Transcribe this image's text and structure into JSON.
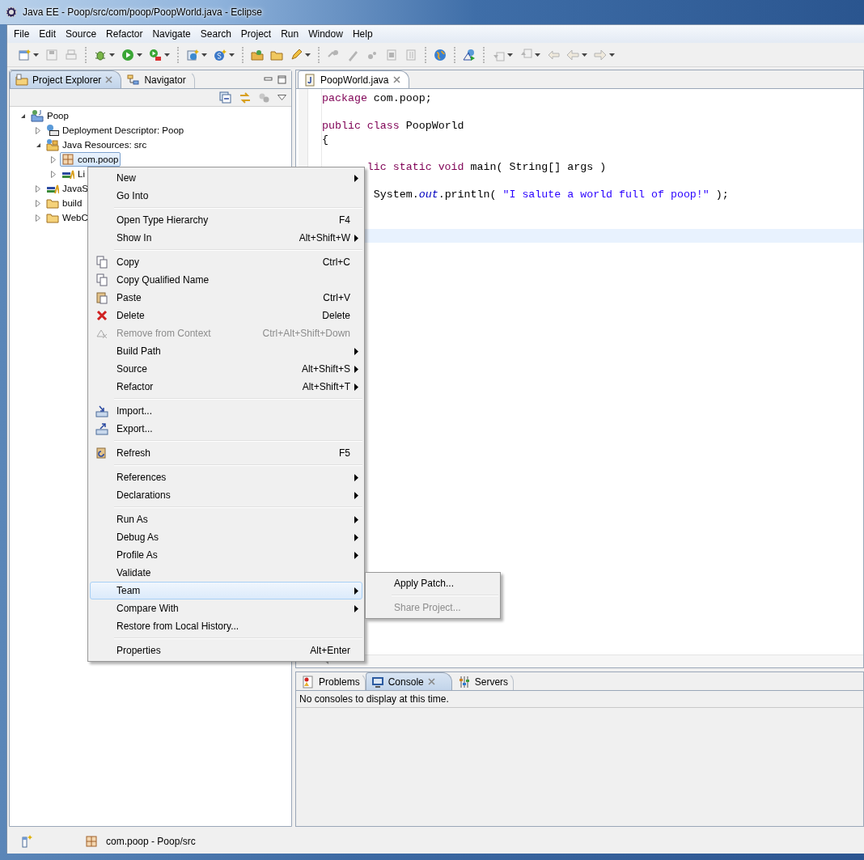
{
  "window": {
    "title": "Java EE - Poop/src/com/poop/PoopWorld.java - Eclipse"
  },
  "menubar": [
    "File",
    "Edit",
    "Source",
    "Refactor",
    "Navigate",
    "Search",
    "Project",
    "Run",
    "Window",
    "Help"
  ],
  "toolbar": [
    [
      {
        "dropdown": true,
        "disabled": false
      },
      {
        "dropdown": false,
        "disabled": true
      },
      {
        "dropdown": false,
        "disabled": true
      }
    ],
    [
      {
        "dropdown": true,
        "disabled": false
      },
      {
        "dropdown": true,
        "disabled": false
      },
      {
        "dropdown": true,
        "disabled": false
      }
    ],
    [
      {
        "dropdown": true,
        "disabled": false
      },
      {
        "dropdown": true,
        "disabled": false
      }
    ],
    [
      {
        "dropdown": false,
        "disabled": false
      },
      {
        "dropdown": false,
        "disabled": false
      },
      {
        "dropdown": true,
        "disabled": false
      }
    ],
    [
      {
        "dropdown": false,
        "disabled": true
      },
      {
        "dropdown": false,
        "disabled": true
      },
      {
        "dropdown": false,
        "disabled": true
      },
      {
        "dropdown": false,
        "disabled": true
      },
      {
        "dropdown": false,
        "disabled": true
      }
    ],
    [
      {
        "dropdown": false,
        "disabled": false
      }
    ],
    [
      {
        "dropdown": false,
        "disabled": false
      }
    ],
    [
      {
        "dropdown": true,
        "disabled": true
      },
      {
        "dropdown": true,
        "disabled": true
      },
      {
        "dropdown": false,
        "disabled": true
      },
      {
        "dropdown": true,
        "disabled": true
      },
      {
        "dropdown": true,
        "disabled": true
      }
    ]
  ],
  "project_explorer": {
    "tabs": [
      {
        "label": "Project Explorer",
        "selected": true
      },
      {
        "label": "Navigator",
        "selected": false
      }
    ],
    "tree": [
      {
        "label": "Poop",
        "kind": "project",
        "expanded": true,
        "selected": false,
        "children": [
          {
            "label": "Deployment Descriptor: Poop",
            "kind": "descriptor",
            "expanded": false,
            "selected": false
          },
          {
            "label": "Java Resources: src",
            "kind": "resources",
            "expanded": true,
            "selected": false,
            "children": [
              {
                "label": "com.poop",
                "kind": "package",
                "expanded": false,
                "selected": true
              },
              {
                "label": "Li",
                "kind": "library",
                "expanded": false,
                "selected": false
              }
            ]
          },
          {
            "label": "JavaS",
            "kind": "library",
            "expanded": false,
            "selected": false
          },
          {
            "label": "build",
            "kind": "folder",
            "expanded": false,
            "selected": false
          },
          {
            "label": "WebC",
            "kind": "folder",
            "expanded": false,
            "selected": false
          }
        ]
      }
    ]
  },
  "editor": {
    "tab": {
      "label": "PoopWorld.java"
    },
    "lines": [
      {
        "kind": "code",
        "current": false,
        "tokens": [
          {
            "kind": "keyword",
            "text": "package"
          },
          {
            "kind": "plain",
            "text": " com.poop;"
          }
        ]
      },
      {
        "kind": "blank",
        "current": false
      },
      {
        "kind": "code",
        "current": false,
        "tokens": [
          {
            "kind": "keyword",
            "text": "public"
          },
          {
            "kind": "keyword",
            "text": " class"
          },
          {
            "kind": "plain",
            "text": " PoopWorld"
          }
        ]
      },
      {
        "kind": "code",
        "current": false,
        "tokens": [
          {
            "kind": "plain",
            "text": "{"
          }
        ]
      },
      {
        "kind": "blank",
        "current": false
      },
      {
        "kind": "code",
        "current": false,
        "tokens": [
          {
            "kind": "keyword",
            "text": "       lic"
          },
          {
            "kind": "keyword",
            "text": " static"
          },
          {
            "kind": "keyword",
            "text": " void"
          },
          {
            "kind": "plain",
            "text": " main( String[] args )"
          }
        ]
      },
      {
        "kind": "blank",
        "current": false
      },
      {
        "kind": "code",
        "current": false,
        "tokens": [
          {
            "kind": "plain",
            "text": "        System."
          },
          {
            "kind": "field",
            "text": "out"
          },
          {
            "kind": "plain",
            "text": ".println( "
          },
          {
            "kind": "string",
            "text": "\"I salute a world full of poop!\""
          },
          {
            "kind": "plain",
            "text": " );"
          }
        ]
      },
      {
        "kind": "blank",
        "current": false
      },
      {
        "kind": "blank",
        "current": false
      },
      {
        "kind": "blank",
        "current": true
      }
    ]
  },
  "bottom_panel": {
    "tabs": [
      {
        "label": "Problems",
        "selected": false
      },
      {
        "label": "Console",
        "selected": true
      },
      {
        "label": "Servers",
        "selected": false
      }
    ],
    "message": "No consoles to display at this time."
  },
  "status_bar": {
    "text": "com.poop - Poop/src"
  },
  "context_menu": {
    "items": [
      {
        "kind": "item",
        "label": "New",
        "submenu": true,
        "disabled": false,
        "selected": false
      },
      {
        "kind": "item",
        "label": "Go Into",
        "submenu": false,
        "disabled": false,
        "selected": false
      },
      {
        "kind": "separator"
      },
      {
        "kind": "item",
        "label": "Open Type Hierarchy",
        "shortcut": "F4",
        "submenu": false,
        "disabled": false,
        "selected": false
      },
      {
        "kind": "item",
        "label": "Show In",
        "shortcut": "Alt+Shift+W",
        "submenu": true,
        "disabled": false,
        "selected": false
      },
      {
        "kind": "separator"
      },
      {
        "kind": "item",
        "label": "Copy",
        "shortcut": "Ctrl+C",
        "submenu": false,
        "disabled": false,
        "selected": false
      },
      {
        "kind": "item",
        "label": "Copy Qualified Name",
        "submenu": false,
        "disabled": false,
        "selected": false
      },
      {
        "kind": "item",
        "label": "Paste",
        "shortcut": "Ctrl+V",
        "submenu": false,
        "disabled": false,
        "selected": false
      },
      {
        "kind": "item",
        "label": "Delete",
        "shortcut": "Delete",
        "submenu": false,
        "disabled": false,
        "selected": false
      },
      {
        "kind": "item",
        "label": "Remove from Context",
        "shortcut": "Ctrl+Alt+Shift+Down",
        "submenu": false,
        "disabled": true,
        "selected": false
      },
      {
        "kind": "item",
        "label": "Build Path",
        "submenu": true,
        "disabled": false,
        "selected": false
      },
      {
        "kind": "item",
        "label": "Source",
        "shortcut": "Alt+Shift+S",
        "submenu": true,
        "disabled": false,
        "selected": false
      },
      {
        "kind": "item",
        "label": "Refactor",
        "shortcut": "Alt+Shift+T",
        "submenu": true,
        "disabled": false,
        "selected": false
      },
      {
        "kind": "separator"
      },
      {
        "kind": "item",
        "label": "Import...",
        "submenu": false,
        "disabled": false,
        "selected": false
      },
      {
        "kind": "item",
        "label": "Export...",
        "submenu": false,
        "disabled": false,
        "selected": false
      },
      {
        "kind": "separator"
      },
      {
        "kind": "item",
        "label": "Refresh",
        "shortcut": "F5",
        "submenu": false,
        "disabled": false,
        "selected": false
      },
      {
        "kind": "separator"
      },
      {
        "kind": "item",
        "label": "References",
        "submenu": true,
        "disabled": false,
        "selected": false
      },
      {
        "kind": "item",
        "label": "Declarations",
        "submenu": true,
        "disabled": false,
        "selected": false
      },
      {
        "kind": "separator"
      },
      {
        "kind": "item",
        "label": "Run As",
        "submenu": true,
        "disabled": false,
        "selected": false
      },
      {
        "kind": "item",
        "label": "Debug As",
        "submenu": true,
        "disabled": false,
        "selected": false
      },
      {
        "kind": "item",
        "label": "Profile As",
        "submenu": true,
        "disabled": false,
        "selected": false
      },
      {
        "kind": "item",
        "label": "Validate",
        "submenu": false,
        "disabled": false,
        "selected": false
      },
      {
        "kind": "item",
        "label": "Team",
        "submenu": true,
        "disabled": false,
        "selected": true
      },
      {
        "kind": "item",
        "label": "Compare With",
        "submenu": true,
        "disabled": false,
        "selected": false
      },
      {
        "kind": "item",
        "label": "Restore from Local History...",
        "submenu": false,
        "disabled": false,
        "selected": false
      },
      {
        "kind": "separator"
      },
      {
        "kind": "item",
        "label": "Properties",
        "shortcut": "Alt+Enter",
        "submenu": false,
        "disabled": false,
        "selected": false
      }
    ]
  },
  "team_submenu": {
    "items": [
      {
        "kind": "item",
        "label": "Apply Patch...",
        "disabled": false
      },
      {
        "kind": "separator"
      },
      {
        "kind": "item",
        "label": "Share Project...",
        "disabled": true
      }
    ]
  }
}
